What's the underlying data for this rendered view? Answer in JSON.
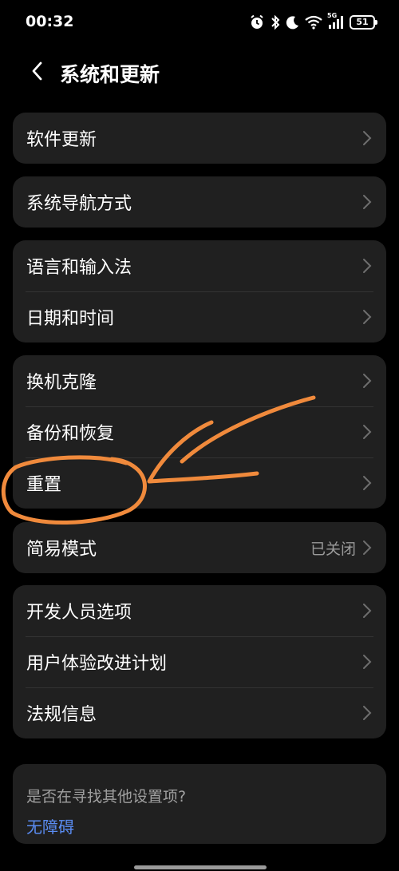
{
  "status_bar": {
    "time": "00:32",
    "battery": "51",
    "network": "5G",
    "icons": [
      "alarm-icon",
      "bluetooth-icon",
      "moon-icon",
      "wifi-icon",
      "signal-icon",
      "battery-icon"
    ]
  },
  "header": {
    "title": "系统和更新",
    "back_icon": "chevron-left-icon"
  },
  "groups": [
    {
      "items": [
        {
          "label": "软件更新"
        }
      ]
    },
    {
      "items": [
        {
          "label": "系统导航方式"
        }
      ]
    },
    {
      "items": [
        {
          "label": "语言和输入法"
        },
        {
          "label": "日期和时间"
        }
      ]
    },
    {
      "items": [
        {
          "label": "换机克隆"
        },
        {
          "label": "备份和恢复"
        },
        {
          "label": "重置"
        }
      ]
    },
    {
      "items": [
        {
          "label": "简易模式",
          "value": "已关闭"
        }
      ]
    },
    {
      "items": [
        {
          "label": "开发人员选项"
        },
        {
          "label": "用户体验改进计划"
        },
        {
          "label": "法规信息"
        }
      ]
    }
  ],
  "search_card": {
    "hint": "是否在寻找其他设置项?",
    "link": "无障碍"
  },
  "colors": {
    "background": "#000000",
    "card": "#202020",
    "text": "#ffffff",
    "secondary_text": "#9a9a9a",
    "link": "#5a8cf2",
    "annotation": "#f08a3c"
  }
}
